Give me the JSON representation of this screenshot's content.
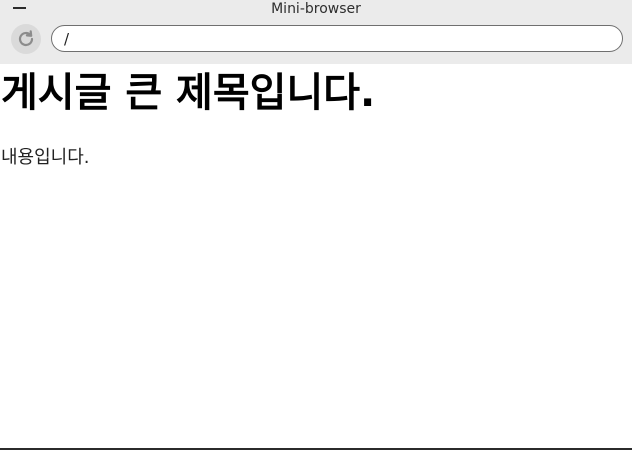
{
  "window": {
    "title": "Mini-browser"
  },
  "toolbar": {
    "reload_icon": "reload-icon",
    "url_value": "/"
  },
  "page": {
    "heading": "게시글 큰 제목입니다.",
    "body": "내용입니다."
  }
}
